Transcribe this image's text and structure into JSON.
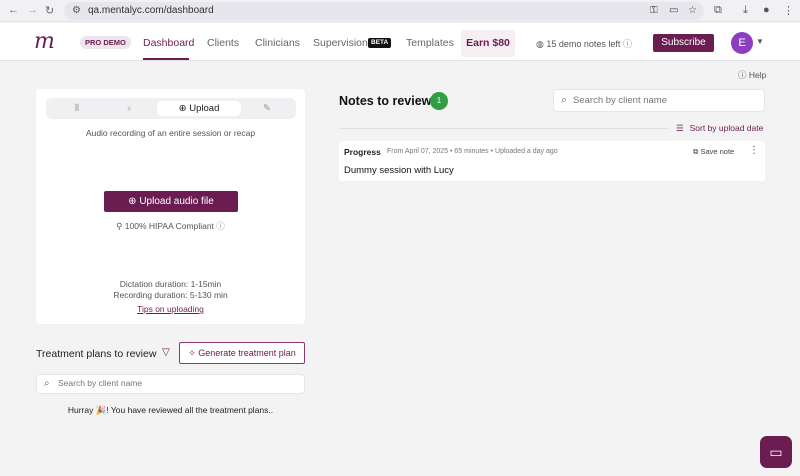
{
  "browser": {
    "url": "qa.mentalyc.com/dashboard",
    "back_glyph": "←",
    "forward_glyph": "→",
    "reload_glyph": "↻"
  },
  "header": {
    "logo": "m",
    "pro_demo": "PRO DEMO",
    "nav": [
      "Dashboard",
      "Clients",
      "Clinicians",
      "Supervision",
      "Templates"
    ],
    "beta": "BETA",
    "earn": "Earn $80",
    "demo_notes": "15 demo notes left",
    "subscribe": "Subscribe",
    "avatar_initial": "E"
  },
  "help": "Help",
  "upload_card": {
    "tabs": [
      "",
      "",
      "Upload",
      ""
    ],
    "caption": "Audio recording of an entire session or recap",
    "upload_button": "Upload audio file",
    "hipaa": "100% HIPAA Compliant",
    "dictation": "Dictation duration: 1-15min",
    "recording": "Recording duration: 5-130 min",
    "tips": "Tips on uploading"
  },
  "treatment_plans": {
    "title": "Treatment plans to review",
    "generate_button": "Generate treatment plan",
    "search_placeholder": "Search by client name",
    "empty_message_before": "Hurray ",
    "empty_emoji": "🎉",
    "empty_message_after": "! You have reviewed all the treatment plans.."
  },
  "notes": {
    "title": "Notes to review",
    "count": "1",
    "search_placeholder": "Search by client name",
    "sort_label": "Sort by upload date",
    "items": [
      {
        "type": "Progress",
        "meta": "From April 07, 2025 • 65 minutes • Uploaded a day ago",
        "title": "Dummy session with Lucy",
        "save_label": "Save note"
      }
    ]
  },
  "colors": {
    "brand": "#6b1d52",
    "badge_green": "#2f9e44",
    "avatar_purple": "#8b3ec0"
  }
}
